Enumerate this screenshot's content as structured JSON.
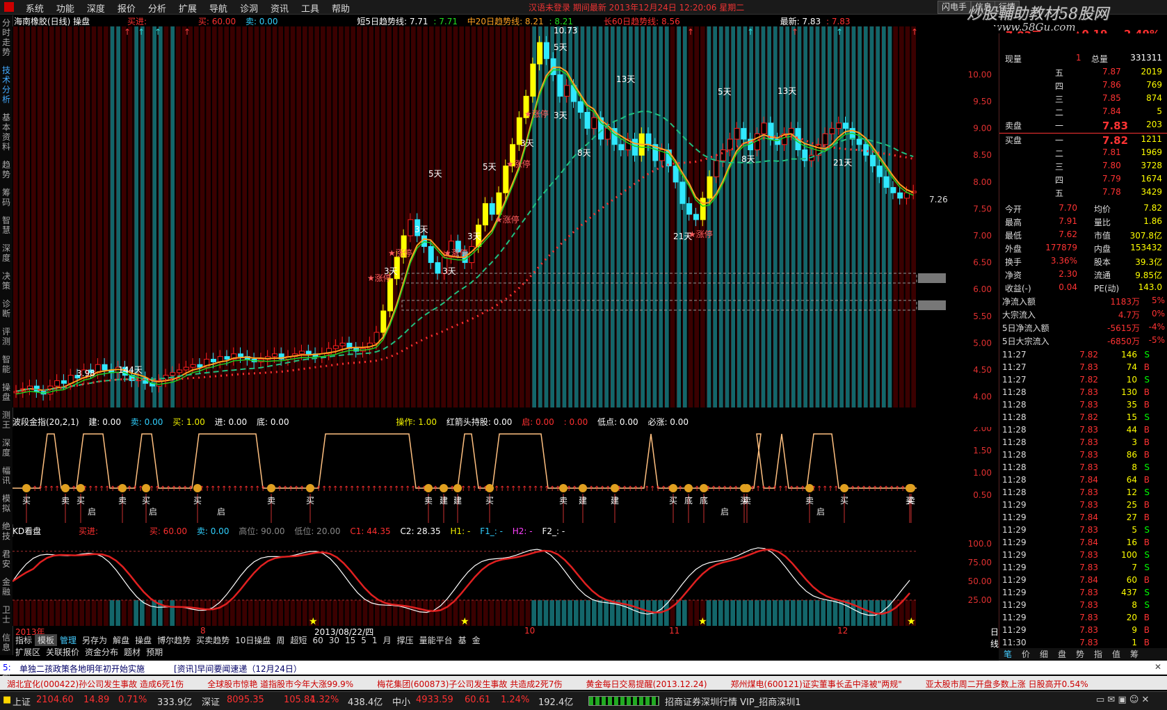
{
  "menu": [
    "系统",
    "功能",
    "深度",
    "报价",
    "分析",
    "扩展",
    "导航",
    "诊洞",
    "资讯",
    "工具",
    "帮助"
  ],
  "title_center": "汉语未登录   期间最新   2013年12月24日  12:20:06  星期二",
  "toolbar_buttons": [
    "闪电手",
    "信息",
    "行情"
  ],
  "watermark": "炒股輔助教材58股网",
  "watermark_url": "www.58Gu.com",
  "left_tabs": [
    "分时走势",
    "技术分析",
    "基本资料",
    "趋势",
    "筹码",
    "智慧",
    "深度",
    "决策",
    "诊断",
    "评测",
    "智能",
    "操盘",
    "测王",
    "深度",
    "幅讯",
    "模拟",
    "绝技",
    "君安",
    "金融",
    "卫士",
    "信息",
    "研报"
  ],
  "main_header": {
    "name": "海南橡胶(日线) 操盘",
    "buy_in": "买进:",
    "buy": "买: 60.00",
    "sell": "卖: 0.00",
    "ma5": "短5日趋势线: 7.71",
    "ma5b": ": 7.71",
    "ma20": "中20日趋势线: 8.21",
    "ma20b": ": 8.21",
    "ma60": "长60日趋势线: 8.56",
    "latest": "最新: 7.83",
    "latest2": ": 7.83"
  },
  "main_yaxis": [
    "10.00",
    "9.50",
    "9.00",
    "8.50",
    "8.00",
    "7.50",
    "7.00",
    "6.50",
    "6.00",
    "5.50",
    "5.00",
    "4.50",
    "4.00"
  ],
  "main_labels": {
    "high": "10.73",
    "low": "3.98",
    "price_right": "7.26",
    "d144": "144天",
    "d5a": "5天",
    "d3a": "3天",
    "d5b": "5天",
    "d3b": "3天",
    "d3c": "3天",
    "d3d": "3天",
    "d5c": "5天",
    "d13a": "13天",
    "d8a": "8天",
    "d5d": "5天",
    "d13b": "13天",
    "d8b": "8天",
    "d21a": "21天",
    "d21b": "21天",
    "d3e": "3天",
    "d3f": "3天",
    "zt": "★涨停"
  },
  "sub1_header": {
    "name": "波段金指(20,2,1)",
    "jian": "建: 0.00",
    "mai": "卖: 0.00",
    "buy": "买: 1.00",
    "jin": "进: 0.00",
    "di": "底: 0.00",
    "caozuo": "操作: 1.00",
    "hold": "红箭头持股: 0.00",
    "qi": "启: 0.00",
    "zero": ": 0.00",
    "didian": "低点: 0.00",
    "bizhang": "必涨: 0.00"
  },
  "sub1_yaxis": [
    "2.00",
    "1.50",
    "1.00",
    "0.50"
  ],
  "sub1_signals": [
    "买",
    "卖",
    "买",
    "卖",
    "买",
    "买",
    "卖",
    "买",
    "卖",
    "建",
    "建",
    "买",
    "卖",
    "建",
    "建",
    "买",
    "底",
    "底",
    "买",
    "卖",
    "卖",
    "买",
    "卖",
    "买"
  ],
  "sub1_qi": [
    "启",
    "启",
    "启",
    "启",
    "启"
  ],
  "sub2_header": {
    "name": "KD看盘",
    "buy_in": "买进:",
    "buy": "买: 60.00",
    "sell": "卖: 0.00",
    "high": "高位: 90.00",
    "low": "低位: 20.00",
    "c1": "C1: 44.35",
    "c2": "C2: 28.35",
    "h1": "H1: -",
    "f1": "F1_: -",
    "h2": "H2: -",
    "f2": "F2_: -"
  },
  "sub2_yaxis": [
    "100.0",
    "75.00",
    "50.00",
    "25.00"
  ],
  "xaxis": {
    "year": "2013年",
    "m8": "8",
    "date": "2013/08/22/四",
    "m10": "10",
    "m11": "11",
    "m12": "12",
    "daily": "日线"
  },
  "bottom_tabs_row1": [
    "指标",
    "模板",
    "管理",
    "另存为",
    "解盘",
    "操盘",
    "博尔趋势",
    "买卖趋势",
    "10日操盘",
    "周",
    "超短",
    "60",
    "30",
    "15",
    "5",
    "1",
    "月",
    "撑压",
    "量能平台",
    "基",
    "金"
  ],
  "bottom_tabs_row2": [
    "扩展区",
    "关联报价",
    "资金分布",
    "题材",
    "预期"
  ],
  "quote": {
    "price_top": "7.83元",
    "chg_top": "▲0.19",
    "pct_top": "2.49%",
    "xianshou_label": "现量",
    "xianshou": "1",
    "zongliang_label": "总量",
    "zongliang": "331311",
    "asks": [
      {
        "lvl": "五",
        "price": "7.87",
        "vol": "2019"
      },
      {
        "lvl": "四",
        "price": "7.86",
        "vol": "769"
      },
      {
        "lvl": "三",
        "price": "7.85",
        "vol": "874"
      },
      {
        "lvl": "二",
        "price": "7.84",
        "vol": "5"
      },
      {
        "lvl": "一",
        "price": "7.83",
        "vol": "203"
      }
    ],
    "bids": [
      {
        "lvl": "一",
        "price": "7.82",
        "vol": "1211"
      },
      {
        "lvl": "二",
        "price": "7.81",
        "vol": "1969"
      },
      {
        "lvl": "三",
        "price": "7.80",
        "vol": "3728"
      },
      {
        "lvl": "四",
        "price": "7.79",
        "vol": "1674"
      },
      {
        "lvl": "五",
        "price": "7.78",
        "vol": "3429"
      }
    ],
    "sell_label": "卖盘",
    "buy_label": "买盘",
    "stats": [
      {
        "l1": "今开",
        "v1": "7.70",
        "l2": "均价",
        "v2": "7.82"
      },
      {
        "l1": "最高",
        "v1": "7.91",
        "l2": "量比",
        "v2": "1.86"
      },
      {
        "l1": "最低",
        "v1": "7.62",
        "l2": "市值",
        "v2": "307.8亿"
      },
      {
        "l1": "外盘",
        "v1": "177879",
        "l2": "内盘",
        "v2": "153432"
      },
      {
        "l1": "换手",
        "v1": "3.36%",
        "l2": "股本",
        "v2": "39.3亿"
      },
      {
        "l1": "净资",
        "v1": "2.30",
        "l2": "流通",
        "v2": "9.85亿"
      },
      {
        "l1": "收益(-)",
        "v1": "0.04",
        "l2": "PE(动)",
        "v2": "143.0"
      }
    ],
    "flows": [
      {
        "label": "净流入额",
        "v": "1183万",
        "p": "5%"
      },
      {
        "label": "大宗流入",
        "v": "4.7万",
        "p": "0%"
      },
      {
        "label": "5日净流入额",
        "v": "-5615万",
        "p": "-4%"
      },
      {
        "label": "5日大宗流入",
        "v": "-6850万",
        "p": "-5%"
      }
    ],
    "ticks": [
      [
        "11:27",
        "7.82",
        "146",
        "S"
      ],
      [
        "11:27",
        "7.83",
        "74",
        "B"
      ],
      [
        "11:27",
        "7.82",
        "10",
        "S"
      ],
      [
        "11:28",
        "7.83",
        "130",
        "B"
      ],
      [
        "11:28",
        "7.83",
        "35",
        "B"
      ],
      [
        "11:28",
        "7.82",
        "15",
        "S"
      ],
      [
        "11:28",
        "7.83",
        "44",
        "B"
      ],
      [
        "11:28",
        "7.83",
        "3",
        "B"
      ],
      [
        "11:28",
        "7.83",
        "86",
        "B"
      ],
      [
        "11:28",
        "7.83",
        "8",
        "S"
      ],
      [
        "11:28",
        "7.84",
        "64",
        "B"
      ],
      [
        "11:28",
        "7.83",
        "12",
        "S"
      ],
      [
        "11:29",
        "7.83",
        "25",
        "B"
      ],
      [
        "11:29",
        "7.84",
        "27",
        "B"
      ],
      [
        "11:29",
        "7.83",
        "5",
        "S"
      ],
      [
        "11:29",
        "7.84",
        "16",
        "B"
      ],
      [
        "11:29",
        "7.83",
        "100",
        "S"
      ],
      [
        "11:29",
        "7.83",
        "7",
        "S"
      ],
      [
        "11:29",
        "7.84",
        "60",
        "B"
      ],
      [
        "11:29",
        "7.83",
        "437",
        "S"
      ],
      [
        "11:29",
        "7.83",
        "8",
        "S"
      ],
      [
        "11:29",
        "7.83",
        "20",
        "B"
      ],
      [
        "11:29",
        "7.83",
        "9",
        "B"
      ],
      [
        "11:30",
        "7.83",
        "1",
        "B"
      ]
    ]
  },
  "right_tabs": [
    "笔",
    "价",
    "细",
    "盘",
    "势",
    "指",
    "值",
    "筹"
  ],
  "news": {
    "prefix": "5:",
    "item1": "单独二孩政策各地明年初开始实施",
    "item2": "[资讯]早间要闻速递（12月24日）"
  },
  "ticker": [
    "湖北宜化(000422)孙公司发生事故 造成6死1伤",
    "全球股市惊艳 道指股市今年大涨99.9%",
    "梅花集团(600873)子公司发生事故 共造成2死7伤",
    "黄金每日交易提醒(2013.12.24)",
    "郑州煤电(600121)证实董事长孟中泽被\"两规\"",
    "亚太股市周二开盘多数上涨 日股高开0.54%"
  ],
  "status": {
    "sh_label": "上证",
    "sh": "2104.60",
    "sh_chg": "14.89",
    "sh_pct": "0.71%",
    "sh_amt": "333.9亿",
    "sz_label": "深证",
    "sz": "8095.35",
    "sz_chg": "105.84",
    "sz_pct": "1.32%",
    "sz_amt": "438.4亿",
    "zx_label": "中小",
    "zx": "4933.59",
    "zx_chg": "60.61",
    "zx_pct": "1.24%",
    "zx_amt": "192.4亿",
    "server": "招商证券深圳行情 VIP_招商深圳1"
  },
  "colors": {
    "up": "#ff3030",
    "down": "#30e0e0",
    "ma5": "#ffffff",
    "ma20": "#ffa020",
    "ma60": "#ff3030",
    "teal": "#1a9ca0",
    "darkred": "#4a0000"
  }
}
